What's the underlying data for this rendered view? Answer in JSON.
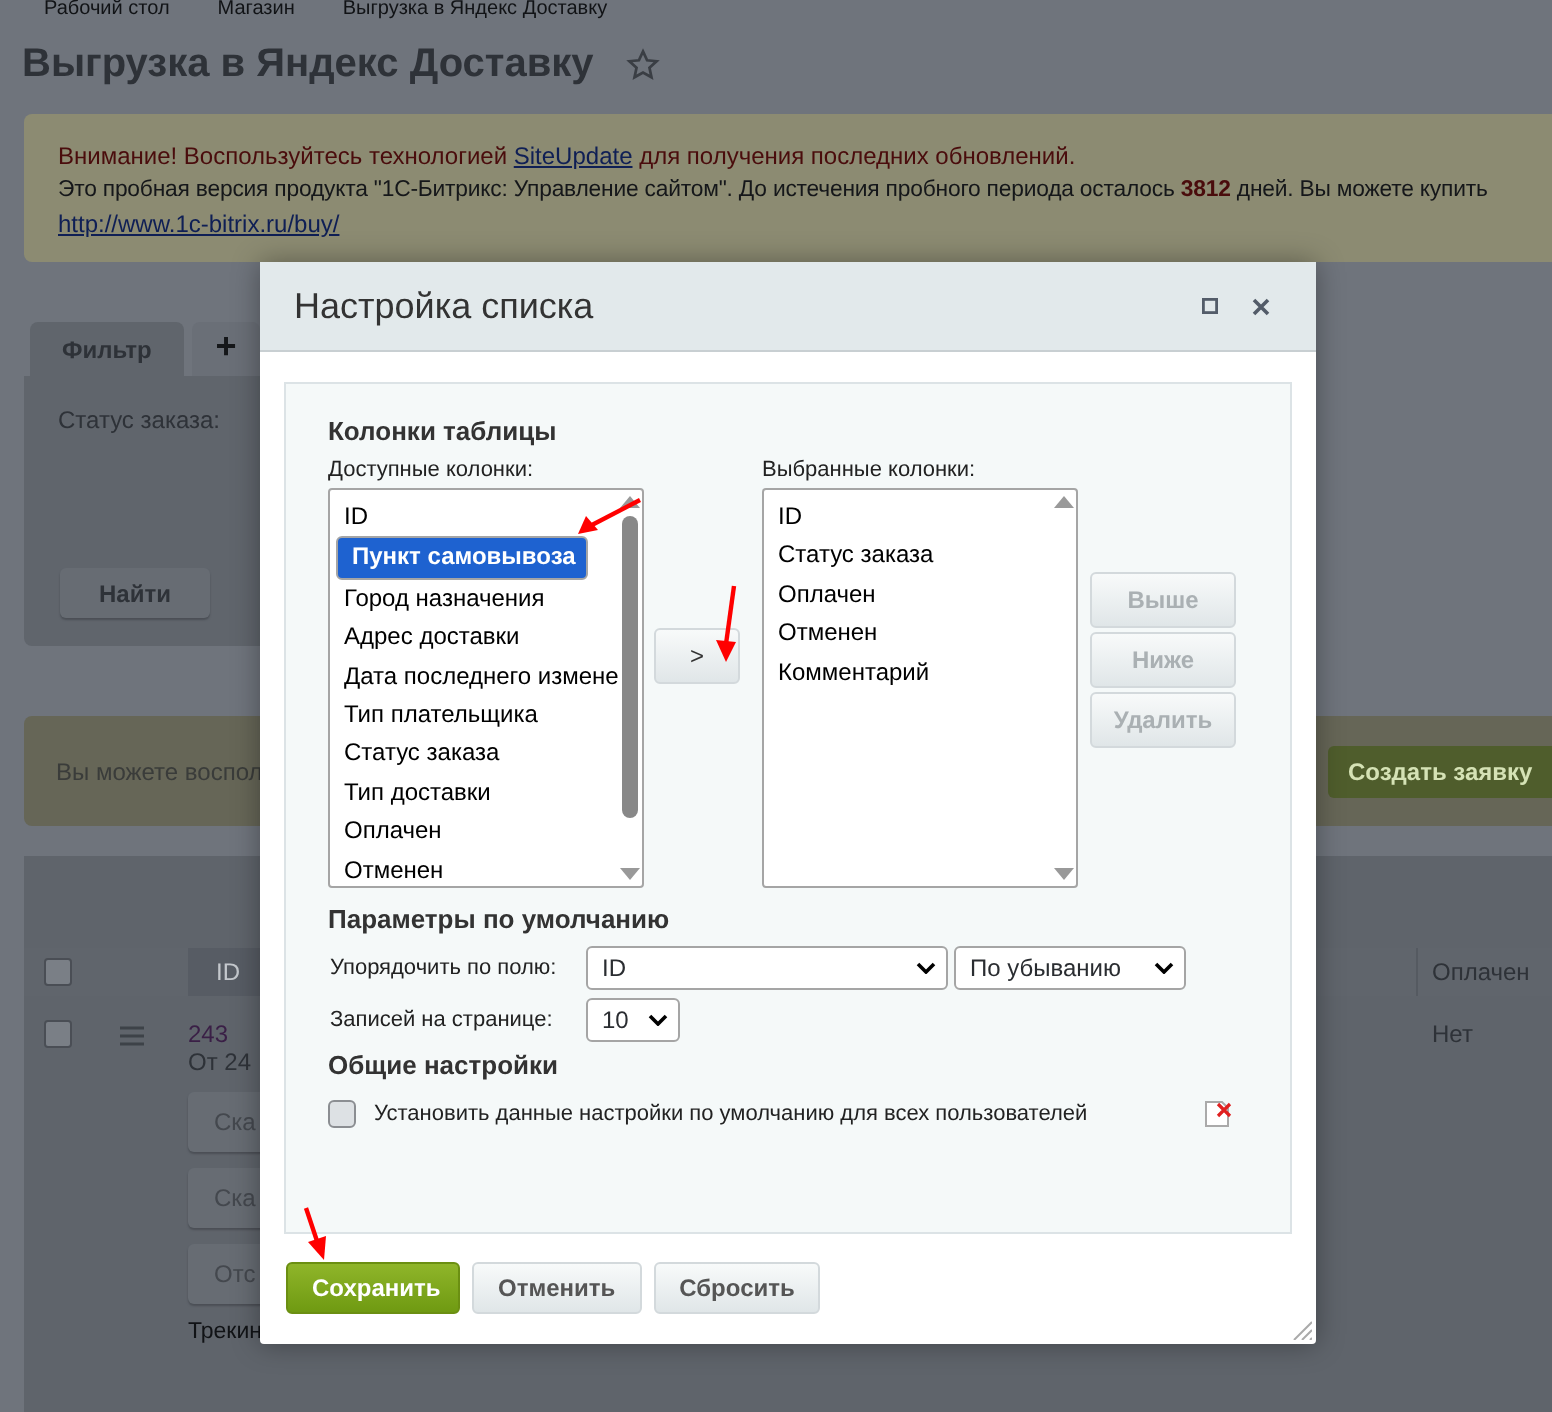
{
  "breadcrumbs": [
    "Рабочий стол",
    "Магазин",
    "Выгрузка в Яндекс Доставку"
  ],
  "page_title": "Выгрузка в Яндекс Доставку",
  "notice": {
    "warning_start": "Внимание! Воспользуйтесь технологией ",
    "warning_link": "SiteUpdate",
    "warning_end": " для получения последних обновлений.",
    "trial": "Это пробная версия продукта \"1С-Битрикс: Управление сайтом\". До истечения пробного периода осталось **3812** дней. Вы можете купить",
    "buy_link": "http://www.1c-bitrix.ru/buy/"
  },
  "filter": {
    "tabs": [
      {
        "label": "Фильтр",
        "selected": true
      },
      {
        "label": "+",
        "selected": false
      }
    ],
    "field_label": "Статус заказа:",
    "find_button": "Найти"
  },
  "info_bar": {
    "text": "Вы можете воспол",
    "button": "Создать заявку"
  },
  "table": {
    "select_all": {
      "checked": false
    },
    "columns": [
      {
        "label": "ID"
      },
      {
        "label": "Оплачен"
      }
    ],
    "rows": [
      {
        "checked": false,
        "number": "243",
        "date": "От 24",
        "actions": [
          "Ска",
          "Ска",
          "Отс"
        ],
        "tracking": "Трекин",
        "paid": "Нет"
      }
    ]
  },
  "dialog": {
    "title": "Настройка списка",
    "section_columns": "Колонки таблицы",
    "available_label": "Доступные колонки:",
    "available": [
      {
        "label": "ID",
        "selected": false
      },
      {
        "label": "Пункт самовывоза",
        "selected": true
      },
      {
        "label": "Город назначения",
        "selected": false
      },
      {
        "label": "Адрес доставки",
        "selected": false
      },
      {
        "label": "Дата последнего измене",
        "selected": false
      },
      {
        "label": "Тип плательщика",
        "selected": false
      },
      {
        "label": "Статус заказа",
        "selected": false
      },
      {
        "label": "Тип доставки",
        "selected": false
      },
      {
        "label": "Оплачен",
        "selected": false
      },
      {
        "label": "Отменен",
        "selected": false
      }
    ],
    "move_button": ">",
    "chosen_label": "Выбранные колонки:",
    "chosen": [
      {
        "label": "ID",
        "selected": false
      },
      {
        "label": "Статус заказа",
        "selected": false
      },
      {
        "label": "Оплачен",
        "selected": false
      },
      {
        "label": "Отменен",
        "selected": false
      },
      {
        "label": "Комментарий",
        "selected": false
      }
    ],
    "order_buttons": [
      {
        "label": "Выше",
        "disabled": true
      },
      {
        "label": "Ниже",
        "disabled": true
      },
      {
        "label": "Удалить",
        "disabled": true
      }
    ],
    "section_defaults": "Параметры по умолчанию",
    "sort_label": "Упорядочить по полю:",
    "sort_field": "ID",
    "sort_order": "По убыванию",
    "per_page_label": "Записей на странице:",
    "per_page": "10",
    "section_general": "Общие настройки",
    "apply_all": {
      "label": "Установить данные настройки по умолчанию для всех пользователей",
      "checked": false
    },
    "buttons": [
      {
        "label": "Сохранить",
        "kind": "primary"
      },
      {
        "label": "Отменить",
        "kind": "default"
      },
      {
        "label": "Сбросить",
        "kind": "default"
      }
    ]
  }
}
